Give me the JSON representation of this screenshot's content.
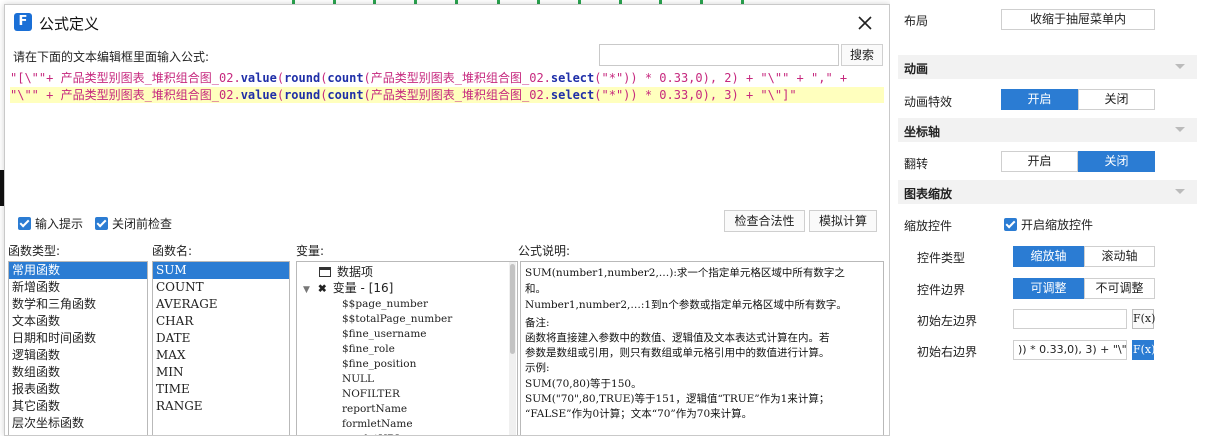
{
  "dialog": {
    "title": "公式定义",
    "logo_text": "F",
    "prompt": "请在下面的文本编辑框里面输入公式:",
    "search": {
      "value": "",
      "button": "搜索"
    },
    "formula": {
      "line1": [
        {
          "t": "\"[\\\"\"+ ",
          "c": "str"
        },
        {
          "t": "产品类型别图表_堆积组合图_02.",
          "c": "str"
        },
        {
          "t": "value",
          "c": "kw"
        },
        {
          "t": "(",
          "c": "op"
        },
        {
          "t": "round",
          "c": "kw"
        },
        {
          "t": "(",
          "c": "op"
        },
        {
          "t": "count",
          "c": "kw"
        },
        {
          "t": "(",
          "c": "op"
        },
        {
          "t": "产品类型别图表_堆积组合图_02.",
          "c": "str"
        },
        {
          "t": "select",
          "c": "kw"
        },
        {
          "t": "(\"*\")) * 0.33,0), 2) + \"\\\"\" + \",\" +",
          "c": "op"
        }
      ],
      "line2": [
        {
          "t": "\"\\\"\" + ",
          "c": "str"
        },
        {
          "t": "产品类型别图表_堆积组合图_02.",
          "c": "str"
        },
        {
          "t": "value",
          "c": "kw"
        },
        {
          "t": "(",
          "c": "op"
        },
        {
          "t": "round",
          "c": "kw"
        },
        {
          "t": "(",
          "c": "op"
        },
        {
          "t": "count",
          "c": "kw"
        },
        {
          "t": "(",
          "c": "op"
        },
        {
          "t": "产品类型别图表_堆积组合图_02.",
          "c": "str"
        },
        {
          "t": "select",
          "c": "kw"
        },
        {
          "t": "(\"*\")) * 0.33,0), 3) + \"\\\"]\"",
          "c": "op"
        }
      ]
    },
    "options": {
      "input_hint": "输入提示",
      "check_before_close": "关闭前检查",
      "check_button": "检查合法性",
      "simulate_button": "模拟计算"
    },
    "columns": {
      "function_type": "函数类型:",
      "function_name": "函数名:",
      "variables": "变量:",
      "description": "公式说明:"
    },
    "function_types": [
      "常用函数",
      "新增函数",
      "数学和三角函数",
      "文本函数",
      "日期和时间函数",
      "逻辑函数",
      "数组函数",
      "报表函数",
      "其它函数",
      "层次坐标函数"
    ],
    "function_names": [
      "SUM",
      "COUNT",
      "AVERAGE",
      "CHAR",
      "DATE",
      "MAX",
      "MIN",
      "TIME",
      "RANGE"
    ],
    "variables": {
      "data_item": "数据项",
      "group": "变量 - [16]",
      "items": [
        "$$page_number",
        "$$totalPage_number",
        "$fine_username",
        "$fine_role",
        "$fine_position",
        "NULL",
        "NOFILTER",
        "reportName",
        "formletName",
        "servletURL"
      ]
    },
    "description_lines": [
      "SUM(number1,number2,…):求一个指定单元格区域中所有数字之",
      "和。",
      "Number1,number2,…:1到n个参数或指定单元格区域中所有数字。",
      "备注:",
      "函数将直接建入参数中的数值、逻辑值及文本表达式计算在内。若",
      "参数是数组或引用，则只有数组或单元格引用中的数值进行计算。",
      "示例:",
      "SUM(70,80)等于150。",
      "SUM(\"70\",80,TRUE)等于151，逻辑值“TRUE”作为1来计算；",
      "“FALSE”作为0计算；文本“70”作为70来计算。"
    ]
  },
  "panel": {
    "layout_label": "布局",
    "layout_value": "收缩于抽屉菜单内",
    "animation_section": "动画",
    "animation_effect_label": "动画特效",
    "animation_on": "开启",
    "animation_off": "关闭",
    "axis_section": "坐标轴",
    "flip_label": "翻转",
    "flip_on": "开启",
    "flip_off": "关闭",
    "zoom_section": "图表缩放",
    "zoom_control_label": "缩放控件",
    "enable_zoom_label": "开启缩放控件",
    "control_type_label": "控件类型",
    "control_type_zoom_axis": "缩放轴",
    "control_type_scroll_axis": "滚动轴",
    "control_border_label": "控件边界",
    "border_adjustable": "可调整",
    "border_fixed": "不可调整",
    "initial_left_label": "初始左边界",
    "initial_left_value": "",
    "initial_right_label": "初始右边界",
    "initial_right_value": ")) * 0.33,0), 3) + \"\\\"]\"",
    "fx_label": "F(x)",
    "accent_color": "#2b7cd3"
  }
}
